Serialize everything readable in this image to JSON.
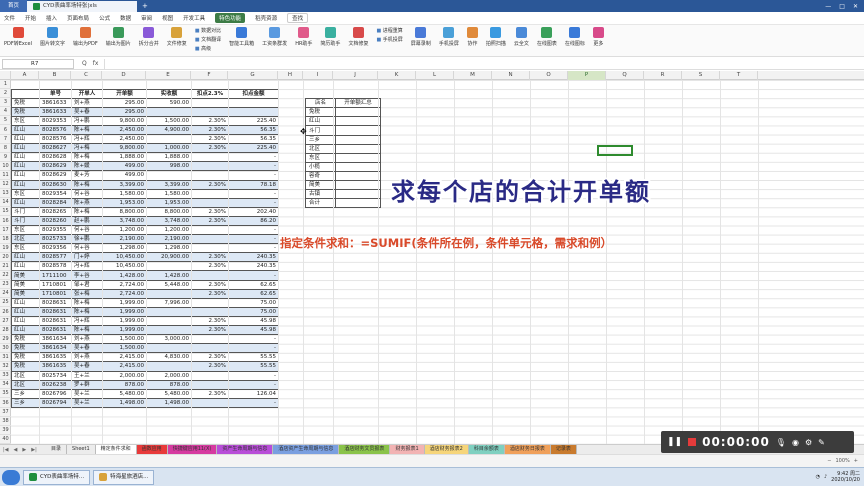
{
  "titlebar": {
    "home_tab": "首页",
    "file_tab": "CYD表曲率场特张|xls",
    "new_tab": "+"
  },
  "menubar": {
    "items": [
      "文件",
      "开始",
      "插入",
      "页面布局",
      "公式",
      "数据",
      "审阅",
      "视图",
      "开发工具",
      "特色功能",
      "稻壳资源",
      "查找"
    ],
    "active_index": 9
  },
  "ribbon": {
    "buttons": [
      "PDF转Excel",
      "图片转文字",
      "输出为PDF",
      "输出为图片",
      "拆分合并",
      "文件修复",
      "智能工具箱",
      "工资条群发",
      "HR助手",
      "简历助手",
      "文档修复",
      "屏幕录制",
      "手机投屏",
      "协作",
      "拍照扫描",
      "云全文",
      "在线图表",
      "在线图标",
      "更多"
    ],
    "stack1": [
      "数据对比",
      "文档翻译",
      "高级"
    ],
    "stack2": [
      "进程重算",
      "手机投屏"
    ]
  },
  "formulabar": {
    "namebox": "R7",
    "icons": [
      "Q",
      "fx"
    ]
  },
  "columns": [
    "A",
    "B",
    "C",
    "D",
    "E",
    "F",
    "G",
    "H",
    "I",
    "J",
    "K",
    "L",
    "M",
    "N",
    "O",
    "P",
    "Q",
    "R",
    "S",
    "T"
  ],
  "selected_column": "P",
  "main_table": {
    "headers": [
      "",
      "单号",
      "开单人",
      "开单额",
      "实收额",
      "扣点2.3%",
      "扣点金额"
    ],
    "rows": [
      [
        "免税",
        "3861633",
        "刘+燕",
        "295.00",
        "590.00",
        "",
        ""
      ],
      [
        "免税",
        "3861633",
        "吴+春",
        "295.00",
        "",
        "",
        ""
      ],
      [
        "东区",
        "8029353",
        "冯+鹏",
        "9,800.00",
        "1,500.00",
        "2.30%",
        "225.40"
      ],
      [
        "红山",
        "8028576",
        "陈+梅",
        "2,450.00",
        "4,900.00",
        "2.30%",
        "56.35"
      ],
      [
        "红山",
        "8028576",
        "冯+辉",
        "2,450.00",
        "",
        "2.30%",
        "56.35"
      ],
      [
        "红山",
        "8028627",
        "冯+梅",
        "9,800.00",
        "1,000.00",
        "2.30%",
        "225.40"
      ],
      [
        "红山",
        "8028628",
        "陈+梅",
        "1,888.00",
        "1,888.00",
        "",
        "-"
      ],
      [
        "红山",
        "8028629",
        "陈+媛",
        "499.00",
        "998.00",
        "",
        "-"
      ],
      [
        "红山",
        "8028629",
        "麦+芳",
        "499.00",
        "",
        "",
        "-"
      ],
      [
        "红山",
        "8028630",
        "陈+梅",
        "3,399.00",
        "3,399.00",
        "2.30%",
        "78.18"
      ],
      [
        "东区",
        "8029354",
        "何+谷",
        "1,580.00",
        "1,580.00",
        "",
        "-"
      ],
      [
        "红山",
        "8028284",
        "陈+燕",
        "1,953.00",
        "1,953.00",
        "",
        "-"
      ],
      [
        "斗门",
        "8028265",
        "陈+梅",
        "8,800.00",
        "8,800.00",
        "2.30%",
        "202.40"
      ],
      [
        "斗门",
        "8028260",
        "赵+鹏",
        "3,748.00",
        "3,748.00",
        "2.30%",
        "86.20"
      ],
      [
        "东区",
        "8029355",
        "何+谷",
        "1,200.00",
        "1,200.00",
        "",
        "-"
      ],
      [
        "北区",
        "8025733",
        "徐+鹏",
        "2,190.00",
        "2,190.00",
        "",
        "-"
      ],
      [
        "东区",
        "8029356",
        "何+谷",
        "1,298.00",
        "1,298.00",
        "",
        "-"
      ],
      [
        "红山",
        "8028577",
        "门+婷",
        "10,450.00",
        "20,900.00",
        "2.30%",
        "240.35"
      ],
      [
        "红山",
        "8028578",
        "冯+辉",
        "10,450.00",
        "",
        "2.30%",
        "240.35"
      ],
      [
        "简美",
        "1711100",
        "李+谷",
        "1,428.00",
        "1,428.00",
        "",
        "-"
      ],
      [
        "简美",
        "1710801",
        "邹+君",
        "2,724.00",
        "5,448.00",
        "2.30%",
        "62.65"
      ],
      [
        "简美",
        "1710801",
        "张+梅",
        "2,724.00",
        "",
        "2.30%",
        "62.65"
      ],
      [
        "红山",
        "8028631",
        "陈+梅",
        "1,999.00",
        "7,996.00",
        "",
        "75.00"
      ],
      [
        "红山",
        "8028631",
        "陈+梅",
        "1,999.00",
        "",
        "",
        "75.00"
      ],
      [
        "红山",
        "8028631",
        "冯+辉",
        "1,999.00",
        "",
        "2.30%",
        "45.98"
      ],
      [
        "红山",
        "8028631",
        "陈+梅",
        "1,999.00",
        "",
        "2.30%",
        "45.98"
      ],
      [
        "免税",
        "3861634",
        "刘+燕",
        "1,500.00",
        "3,000.00",
        "",
        "-"
      ],
      [
        "免税",
        "3861634",
        "吴+春",
        "1,500.00",
        "",
        "",
        "-"
      ],
      [
        "免税",
        "3861635",
        "刘+燕",
        "2,415.00",
        "4,830.00",
        "2.30%",
        "55.55"
      ],
      [
        "免税",
        "3861635",
        "吴+春",
        "2,415.00",
        "",
        "2.30%",
        "55.55"
      ],
      [
        "北区",
        "8025734",
        "王+兰",
        "2,000.00",
        "2,000.00",
        "",
        "-"
      ],
      [
        "北区",
        "8026238",
        "罗+群",
        "878.00",
        "878.00",
        "",
        "-"
      ],
      [
        "三乡",
        "8026796",
        "吴+兰",
        "5,480.00",
        "5,480.00",
        "2.30%",
        "126.04"
      ],
      [
        "三乡",
        "8026794",
        "吴+兰",
        "1,498.00",
        "1,498.00",
        "",
        "-"
      ]
    ]
  },
  "shop_table": {
    "headers": [
      "店名",
      "开单额汇总"
    ],
    "shops": [
      "免税",
      "红山",
      "斗门",
      "三乡",
      "北区",
      "东区",
      "小榄",
      "容奇",
      "简美",
      "古镇",
      "合计"
    ]
  },
  "overlay": {
    "title": "求每个店的合计开单额",
    "formula": "指定条件求和：=SUMIF(条件所在例，条件单元格，需求和例）"
  },
  "sheet_tabs": {
    "nav": [
      "|◀",
      "◀",
      "▶",
      "▶|"
    ],
    "tabs": [
      {
        "label": "目录",
        "color": "#ececec"
      },
      {
        "label": "Sheet1",
        "color": "#ececec"
      },
      {
        "label": "精定条件求和",
        "color": "#ffffff"
      },
      {
        "label": "函数应用",
        "color": "#e83a3a"
      },
      {
        "label": "快捷键应用11(X)",
        "color": "#d63aa0"
      },
      {
        "label": "资产生命周期与信息",
        "color": "#b84dd8"
      },
      {
        "label": "酒店资产生命周期与信息",
        "color": "#7a9fe0"
      },
      {
        "label": "酒店财务文员报表",
        "color": "#8ac34a"
      },
      {
        "label": "财务报表1",
        "color": "#f2b3b3"
      },
      {
        "label": "酒店财务报表2",
        "color": "#f6d57a"
      },
      {
        "label": "科目余额表",
        "color": "#7fd0c0"
      },
      {
        "label": "酒店财务日报表",
        "color": "#f0a05a"
      },
      {
        "label": "记录表",
        "color": "#c97b2e"
      }
    ]
  },
  "statusbar": {
    "zoom": "100%"
  },
  "recorder": {
    "time": "00:00:00"
  },
  "taskbar": {
    "tasks": [
      "CYD表曲率场特...",
      "特海星旅酒店..."
    ],
    "time": "9:42 周二",
    "date": "2020/10/20"
  }
}
